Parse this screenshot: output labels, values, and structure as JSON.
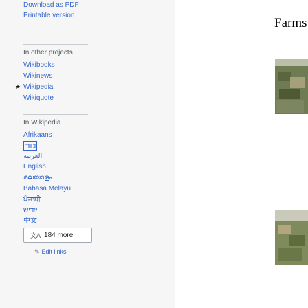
{
  "print_tools": {
    "download_pdf": "Download as PDF",
    "printable": "Printable version"
  },
  "other_projects": {
    "heading": "In other projects",
    "items": [
      "Wikibooks",
      "Wikinews",
      "Wikipedia",
      "Wikiquote"
    ],
    "starred_item": "Wikipedia"
  },
  "languages": {
    "heading": "In Wikipedia",
    "items": [
      "Afrikaans",
      "العربية",
      "English",
      "മലയാളം",
      "Bahasa Melayu",
      "ਪੰਜਾਬੀ",
      "ייִדיש",
      "中文"
    ],
    "icon_item_name": "abbreviation-glyph-icon",
    "more_button": "184 more",
    "edit_links": "Edit links"
  },
  "main": {
    "heading": "Farms"
  },
  "colors": {
    "link": "#3366cc",
    "sidebar_bg": "#f6f6f6",
    "content_bg": "#ffffff",
    "muted_text": "#54595d"
  }
}
